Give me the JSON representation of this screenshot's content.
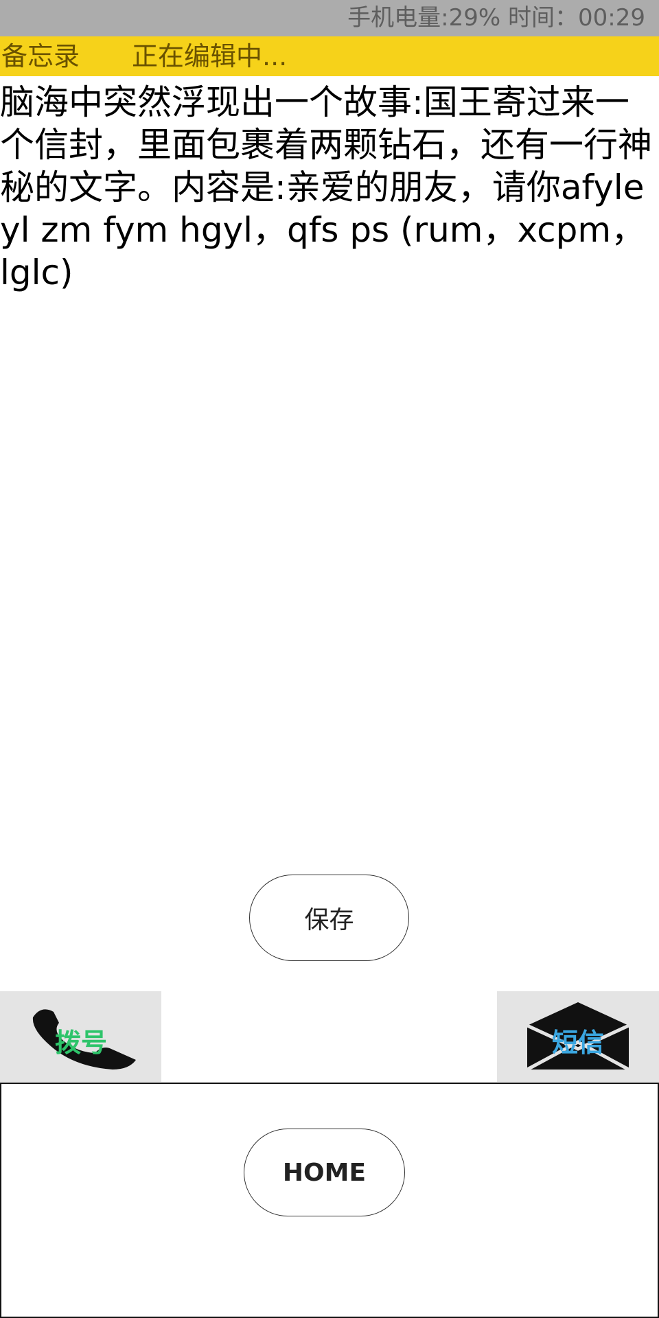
{
  "status_bar": {
    "text": "手机电量:29%  时间：00:29"
  },
  "header": {
    "app_title": "备忘录",
    "edit_status": "正在编辑中..."
  },
  "memo": {
    "content": "脑海中突然浮现出一个故事:国王寄过来一个信封，里面包裹着两颗钻石，还有一行神秘的文字。内容是:亲爱的朋友，请你afyle yl zm fym hgyl，qfs ps (rum，xcpm，lglc)"
  },
  "actions": {
    "save_label": "保存",
    "dial_label": "拨号",
    "sms_label": "短信",
    "home_label": "HOME"
  },
  "icons": {
    "dial": "phone-handset-icon",
    "sms": "envelope-icon"
  },
  "colors": {
    "status_bar_bg": "#acacac",
    "title_bar_bg": "#f6d21a",
    "dial_label": "#2ec46a",
    "sms_label": "#3aa6e0"
  }
}
